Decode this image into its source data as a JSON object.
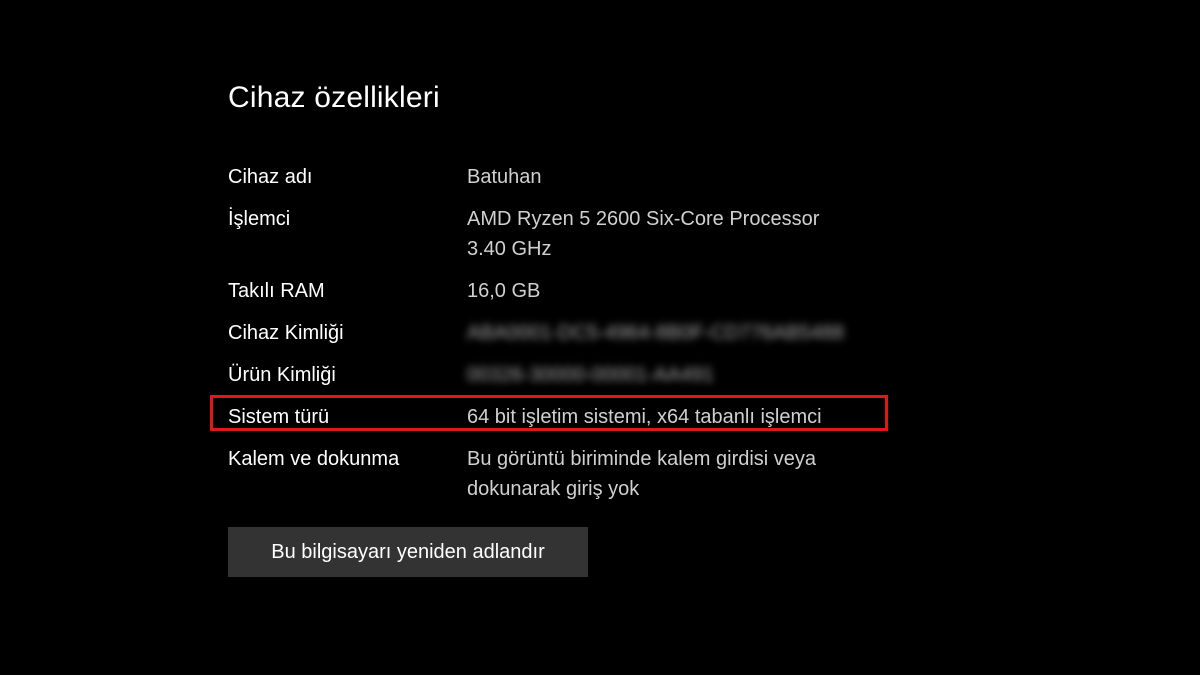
{
  "page": {
    "title": "Cihaz özellikleri"
  },
  "specs": {
    "device_name": {
      "label": "Cihaz adı",
      "value": "Batuhan"
    },
    "processor": {
      "label": "İşlemci",
      "value_line1": "AMD Ryzen 5 2600 Six-Core Processor",
      "value_line2": "3.40 GHz"
    },
    "ram": {
      "label": "Takılı RAM",
      "value": "16,0 GB"
    },
    "device_id": {
      "label": "Cihaz Kimliği",
      "value_obscured": "ABA0001-DC5-4964-8B0F-CD776AB5488"
    },
    "product_id": {
      "label": "Ürün Kimliği",
      "value_obscured": "00326-30000-00001-AA491"
    },
    "system_type": {
      "label": "Sistem türü",
      "value": "64 bit işletim sistemi, x64 tabanlı işlemci",
      "highlighted": true
    },
    "pen_touch": {
      "label": "Kalem ve dokunma",
      "value_line1": "Bu görüntü biriminde kalem girdisi veya",
      "value_line2": "dokunarak giriş yok"
    }
  },
  "actions": {
    "rename_button": "Bu bilgisayarı yeniden adlandır"
  },
  "colors": {
    "background": "#000000",
    "highlight": "#e01818",
    "button_bg": "#333333"
  }
}
